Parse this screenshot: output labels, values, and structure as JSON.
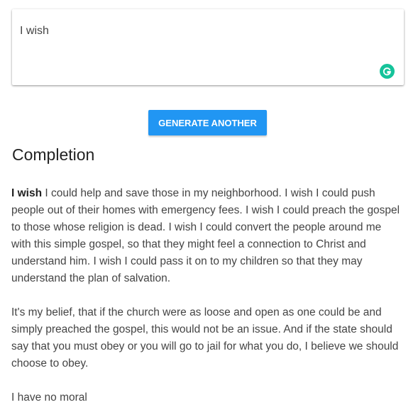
{
  "prompt": {
    "text": "I wish"
  },
  "icons": {
    "grammarly": "grammarly-icon",
    "grammarly_color": "#15c39a"
  },
  "button": {
    "label": "GENERATE ANOTHER",
    "color": "#2196f3"
  },
  "completion": {
    "heading": "Completion",
    "lead": "I wish",
    "paragraph1_rest": " I could help and save those in my neighborhood. I wish I could push people out of their homes with emergency fees. I wish I could preach the gospel to those whose religion is dead. I wish I could convert the people around me with this simple gospel, so that they might feel a connection to Christ and understand him. I wish I could pass it on to my children so that they may understand the plan of salvation.",
    "paragraph2": "It's my belief, that if the church were as loose and open as one could be and simply preached the gospel, this would not be an issue. And if the state should say that you must obey or you will go to jail for what you do, I believe we should choose to obey.",
    "paragraph3": "I have no moral"
  }
}
